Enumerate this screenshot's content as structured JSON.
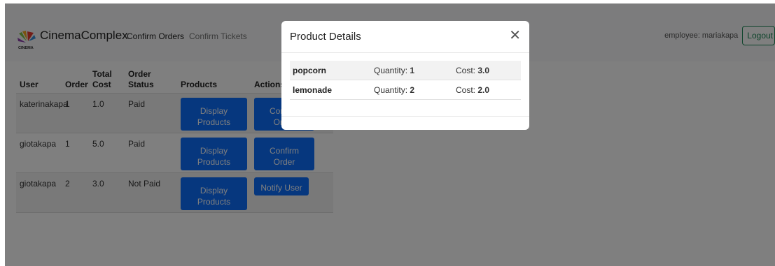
{
  "navbar": {
    "brand_name": "CinemaComplex",
    "logo_text": "CINEMA",
    "links": [
      "Confirm Orders",
      "Confirm Tickets"
    ],
    "user_label": "employee: mariakapa",
    "logout_label": "Logout"
  },
  "table": {
    "headers": {
      "user": "User",
      "order": "Order",
      "total_1": "Total",
      "total_2": "Cost",
      "status_1": "Order",
      "status_2": "Status",
      "products": "Products",
      "actions": "Actions"
    },
    "rows": [
      {
        "user": "katerinakapa",
        "order": "1",
        "total": "1.0",
        "status": "Paid",
        "products_btn": "Display Products",
        "action_btn": "Confirm Order"
      },
      {
        "user": "giotakapa",
        "order": "1",
        "total": "5.0",
        "status": "Paid",
        "products_btn": "Display Products",
        "action_btn": "Confirm Order"
      },
      {
        "user": "giotakapa",
        "order": "2",
        "total": "3.0",
        "status": "Not Paid",
        "products_btn": "Display Products",
        "action_btn": "Notify User"
      }
    ]
  },
  "modal": {
    "title": "Product Details",
    "close_symbol": "✕",
    "qty_label": "Quantity: ",
    "cost_label": "Cost: ",
    "items": [
      {
        "name": "popcorn",
        "quantity": "1",
        "cost": "3.0"
      },
      {
        "name": "lemonade",
        "quantity": "2",
        "cost": "2.0"
      }
    ]
  },
  "colors": {
    "primary": "#0d6efd",
    "success": "#198754",
    "backdrop": "rgba(0,0,0,0.5)"
  }
}
